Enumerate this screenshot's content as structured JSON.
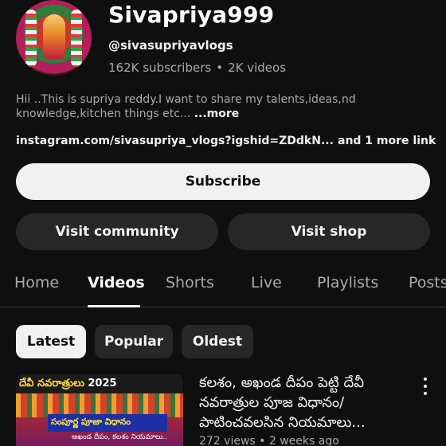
{
  "channel": {
    "name": "Sivapriya999",
    "handle": "@sivasupriyavlogs",
    "subscribers": "162K subscribers",
    "separator": "•",
    "videos": "2K videos",
    "description": "Hii ..This is supriya reddy.I want to share my talents,ideas,nd knowledge,kitchen things etc... ",
    "more_label": "...more",
    "link": "instagram.com/sivasupriya_vlogs?igshid=ZDdkN...",
    "more_links": "and 1 more link"
  },
  "actions": {
    "subscribe": "Subscribe",
    "community": "Visit community",
    "shop": "Visit shop"
  },
  "tabs": [
    "Home",
    "Videos",
    "Shorts",
    "Live",
    "Playlists",
    "Posts"
  ],
  "active_tab": "Videos",
  "chips": [
    "Latest",
    "Popular",
    "Oldest"
  ],
  "active_chip": "Latest",
  "video": {
    "thumb_banner": "దేవీ నవరాత్రులు",
    "thumb_year": "2025",
    "thumb_strip": "సంపూర్ణ పూజా విధానం",
    "thumb_sub": "అఖండ దీపం, కలశం నియమాలు..",
    "title": "కలశం, అఖండ దీపం పెట్టి దేవీ నవరాత్రుల పూజ విధానం/ పాటించవలసిన నియమాలు...",
    "meta": "272 views • 2 weeks ago"
  },
  "colors": {
    "background": "#0f0f0f",
    "primary_text": "#f1f1f1",
    "secondary_text": "#aaaaaa",
    "chip_bg": "#272727"
  }
}
